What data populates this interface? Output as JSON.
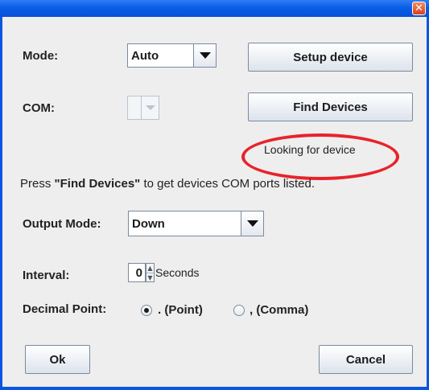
{
  "window": {
    "close_glyph": "✕"
  },
  "mode": {
    "label": "Mode:",
    "value": "Auto"
  },
  "com": {
    "label": "COM:",
    "value": ""
  },
  "buttons": {
    "setup": "Setup device",
    "find": "Find Devices",
    "ok": "Ok",
    "cancel": "Cancel"
  },
  "status": {
    "text": "Looking for device",
    "highlight_color": "#e8232a"
  },
  "hint": {
    "prefix": "Press ",
    "emphasis": "\"Find Devices\"",
    "suffix": " to get devices COM ports listed."
  },
  "output_mode": {
    "label": "Output Mode:",
    "value": "Down"
  },
  "interval": {
    "label": "Interval:",
    "value": "0",
    "unit": "Seconds"
  },
  "decimal_point": {
    "label": "Decimal Point:",
    "options": [
      {
        "label": ". (Point)",
        "selected": true
      },
      {
        "label": ", (Comma)",
        "selected": false
      }
    ]
  }
}
